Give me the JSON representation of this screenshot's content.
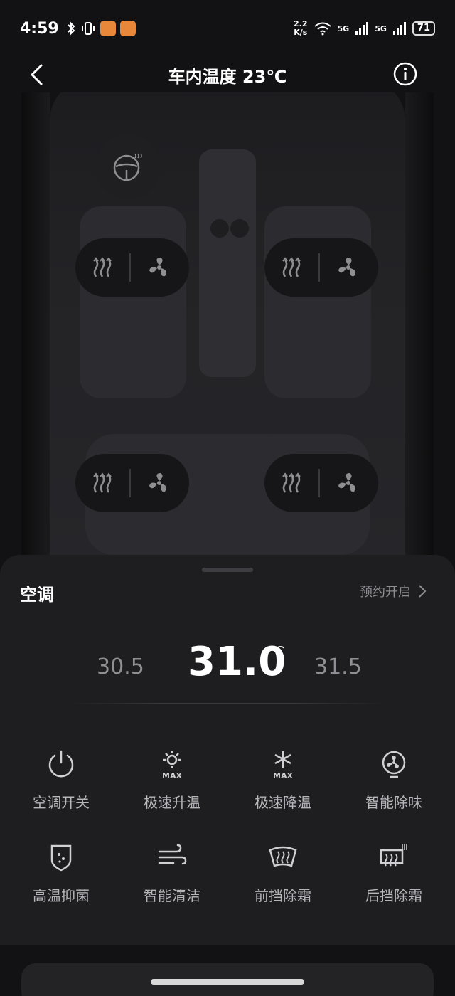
{
  "status_bar": {
    "time": "4:59",
    "net_speed_top": "2.2",
    "net_speed_bottom": "K/s",
    "signal1": "5G",
    "signal2": "5G",
    "battery": "71"
  },
  "header": {
    "title": "车内温度 23℃"
  },
  "panel": {
    "label": "空调",
    "schedule": "预约开启",
    "temp_prev": "30.5",
    "temp_current": "31.0",
    "temp_unit": "℃",
    "temp_next": "31.5"
  },
  "functions": [
    {
      "label": "空调开关",
      "icon": "power-icon"
    },
    {
      "label": "极速升温",
      "icon": "sun-max-icon"
    },
    {
      "label": "极速降温",
      "icon": "snow-max-icon"
    },
    {
      "label": "智能除味",
      "icon": "fan-icon"
    },
    {
      "label": "高温抑菌",
      "icon": "shield-icon"
    },
    {
      "label": "智能清洁",
      "icon": "wind-icon"
    },
    {
      "label": "前挡除霜",
      "icon": "front-defrost-icon"
    },
    {
      "label": "后挡除霜",
      "icon": "rear-defrost-icon"
    }
  ],
  "icon_max_label": "MAX"
}
